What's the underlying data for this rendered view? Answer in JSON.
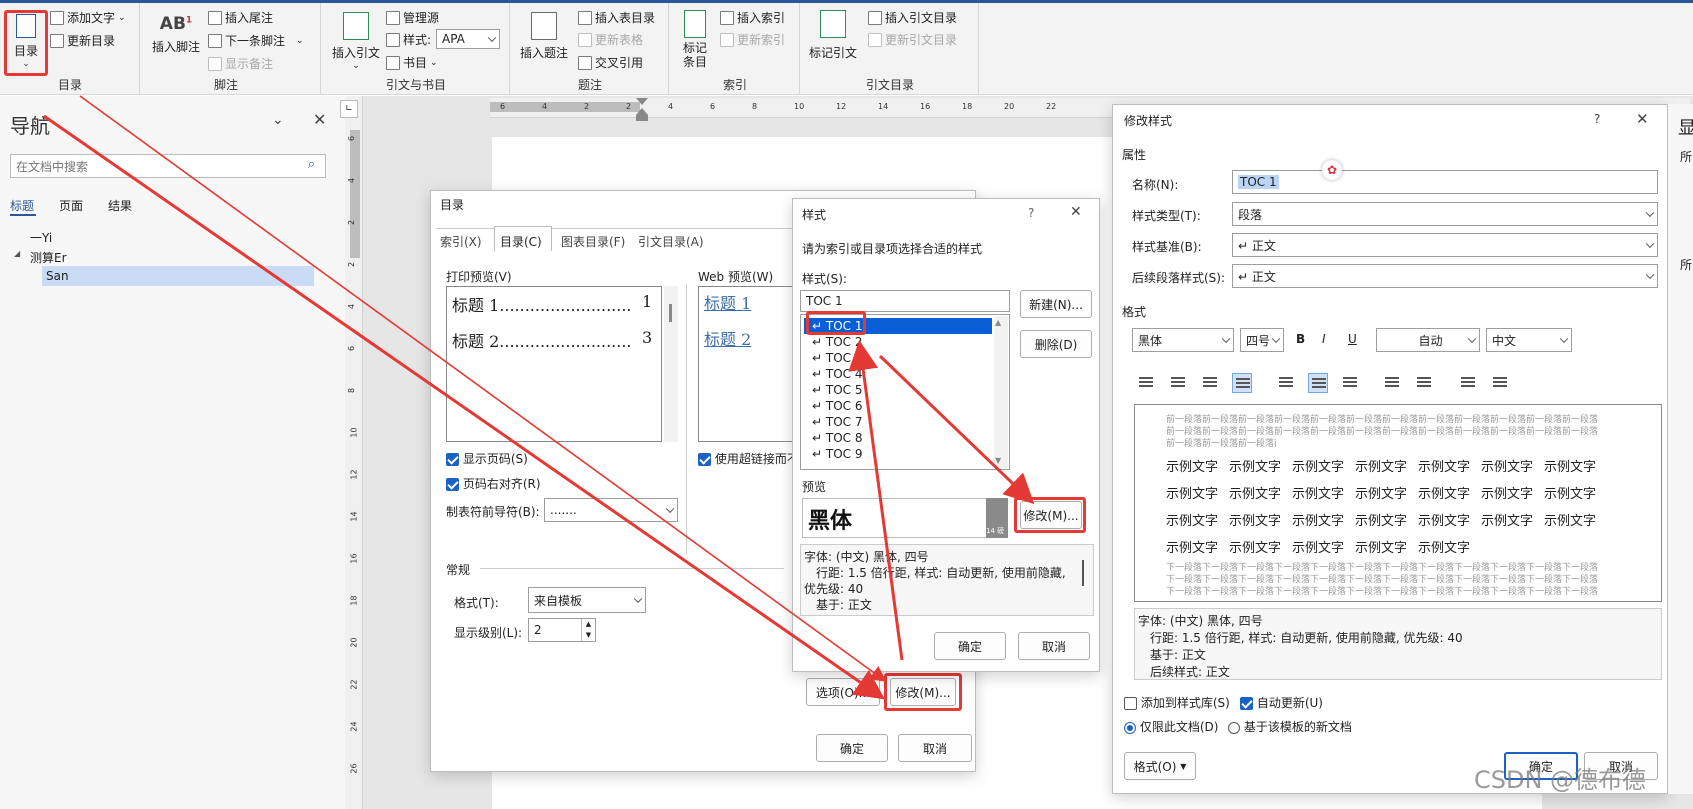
{
  "ribbon": {
    "toc_button": "目录",
    "add_text": "添加文字",
    "update_toc": "更新目录",
    "group_toc": "目录",
    "insert_footnote": "插入脚注",
    "insert_endnote": "插入尾注",
    "next_footnote": "下一条脚注",
    "show_notes": "显示备注",
    "group_footnote": "脚注",
    "insert_citation": "插入引文",
    "manage_sources": "管理源",
    "style_label": "样式:",
    "style_value": "APA",
    "bibliography": "书目",
    "group_citation": "引文与书目",
    "insert_caption": "插入题注",
    "insert_table_of_figures": "插入表目录",
    "update_table": "更新表格",
    "cross_reference": "交叉引用",
    "group_caption": "题注",
    "mark_entry_1": "标记",
    "mark_entry_2": "条目",
    "insert_index": "插入索引",
    "update_index": "更新索引",
    "group_index": "索引",
    "mark_citation": "标记引文",
    "insert_toa": "插入引文目录",
    "update_toa": "更新引文目录",
    "group_toa": "引文目录"
  },
  "nav": {
    "title": "导航",
    "search_placeholder": "在文档中搜索",
    "tabs": [
      "标题",
      "页面",
      "结果"
    ],
    "tree": [
      "一Yi",
      "测算Er",
      "San"
    ]
  },
  "ruler": {
    "h_ticks": [
      "6",
      "4",
      "2",
      "2",
      "4",
      "6",
      "8",
      "10",
      "12",
      "14",
      "16",
      "18",
      "20",
      "22"
    ],
    "v_ticks": [
      "6",
      "4",
      "2",
      "2",
      "4",
      "6",
      "8",
      "10",
      "12",
      "14",
      "16",
      "18",
      "20",
      "22",
      "24",
      "26"
    ]
  },
  "toc_dialog": {
    "title": "目录",
    "tabs": [
      "索引(X)",
      "目录(C)",
      "图表目录(F)",
      "引文目录(A)"
    ],
    "print_preview_label": "打印预览(V)",
    "print_lines": [
      {
        "text": "标题 1..........................",
        "page": "1"
      },
      {
        "text": "标题 2..........................",
        "page": "3"
      }
    ],
    "web_preview_label": "Web 预览(W)",
    "web_lines": [
      "标题 1",
      "标题 2"
    ],
    "show_page_numbers": "显示页码(S)",
    "right_align": "页码右对齐(R)",
    "tab_leader_label": "制表符前导符(B):",
    "tab_leader_value": ".......",
    "use_hyperlinks": "使用超链接而不",
    "general_label": "常规",
    "format_label": "格式(T):",
    "format_value": "来自模板",
    "levels_label": "显示级别(L):",
    "levels_value": "2",
    "options_button": "选项(O)...",
    "modify_button": "修改(M)...",
    "ok": "确定",
    "cancel": "取消"
  },
  "style_dialog": {
    "title": "样式",
    "help": "?",
    "instruction": "请为索引或目录项选择合适的样式",
    "styles_label": "样式(S):",
    "style_input": "TOC 1",
    "styles": [
      "TOC 1",
      "TOC 2",
      "TOC 3",
      "TOC 4",
      "TOC 5",
      "TOC 6",
      "TOC 7",
      "TOC 8",
      "TOC 9"
    ],
    "new_button": "新建(N)...",
    "delete_button": "删除(D)",
    "preview_label": "预览",
    "preview_text": "黑体",
    "preview_size": "14 磅",
    "modify_button": "修改(M)...",
    "description": [
      "字体: (中文) 黑体, 四号",
      "行距: 1.5 倍行距, 样式: 自动更新, 使用前隐藏,",
      "优先级: 40",
      "基于: 正文"
    ],
    "ok": "确定",
    "cancel": "取消"
  },
  "modify_dialog": {
    "title": "修改样式",
    "help": "?",
    "properties_label": "属性",
    "name_label": "名称(N):",
    "name_value": "TOC 1",
    "type_label": "样式类型(T):",
    "type_value": "段落",
    "based_label": "样式基准(B):",
    "based_value": "↵ 正文",
    "following_label": "后续段落样式(S):",
    "following_value": "↵ 正文",
    "format_label": "格式",
    "font_value": "黑体",
    "size_value": "四号",
    "bold": "B",
    "italic": "I",
    "underline": "U",
    "color_value": "自动",
    "lang_value": "中文",
    "prev_para": "前一段落前一段落前一段落前一段落前一段落前一段落前一段落前一段落前一段落前一段落前一段落前一段落",
    "sample_word": "示例文字",
    "next_para": "下一段落下一段落下一段落下一段落下一段落下一段落下一段落下一段落下一段落下一段落下一段落下一段落",
    "description": [
      "字体: (中文) 黑体, 四号",
      "行距: 1.5 倍行距, 样式: 自动更新, 使用前隐藏, 优先级: 40",
      "基于: 正文",
      "后续样式: 正文"
    ],
    "add_to_gallery": "添加到样式库(S)",
    "auto_update": "自动更新(U)",
    "only_this_doc": "仅限此文档(D)",
    "new_docs": "基于该模板的新文档",
    "format_button": "格式(O)",
    "ok": "确定",
    "cancel": "取消"
  },
  "right_edge": {
    "char1": "显",
    "char2": "所",
    "char3": "所"
  },
  "watermark": "CSDN @德布德",
  "colors": {
    "accent": "#2b579a",
    "highlight": "#e53935",
    "selection": "#0a5fd6"
  }
}
